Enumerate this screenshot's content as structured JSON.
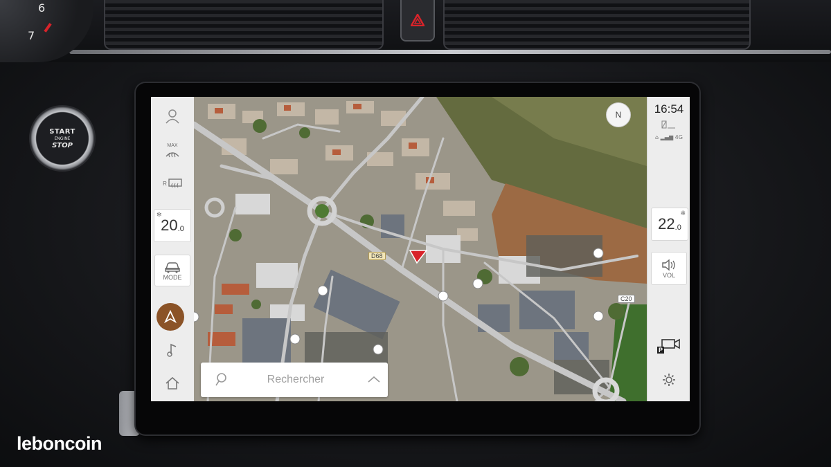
{
  "cluster": {
    "gauge_6": "6",
    "gauge_7": "7"
  },
  "start_button": {
    "line1": "START",
    "line2": "ENGINE",
    "line3": "STOP"
  },
  "left_rail": {
    "max_label": "MAX",
    "rear_label": "R",
    "driver_temp": {
      "whole": "20",
      "decimal": ".0"
    },
    "mode_label": "MODE"
  },
  "right_rail": {
    "time": "16:54",
    "network": "4G",
    "passenger_temp": {
      "whole": "22",
      "decimal": ".0"
    },
    "vol_label": "VOL",
    "park_label": "P"
  },
  "map": {
    "compass": "N",
    "road_d68": "D68",
    "road_c20": "C20",
    "search_placeholder": "Rechercher"
  },
  "watermark": "leboncoin",
  "colors": {
    "nav_accent": "#8b5327",
    "position_arrow": "#d8232a",
    "hazard": "#d8232a"
  }
}
